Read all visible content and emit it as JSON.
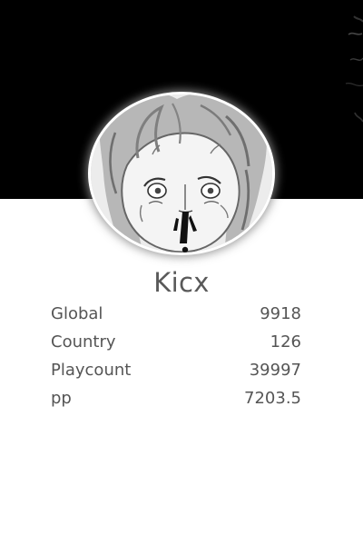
{
  "profile": {
    "username": "Kicx",
    "avatar_icon": "anime-avatar-icon"
  },
  "stats": [
    {
      "label": "Global",
      "value": "9918"
    },
    {
      "label": "Country",
      "value": "126"
    },
    {
      "label": "Playcount",
      "value": "39997"
    },
    {
      "label": "pp",
      "value": "7203.5"
    }
  ],
  "colors": {
    "banner": "#000000",
    "background": "#ffffff",
    "text": "#555555",
    "username": "#595959"
  }
}
